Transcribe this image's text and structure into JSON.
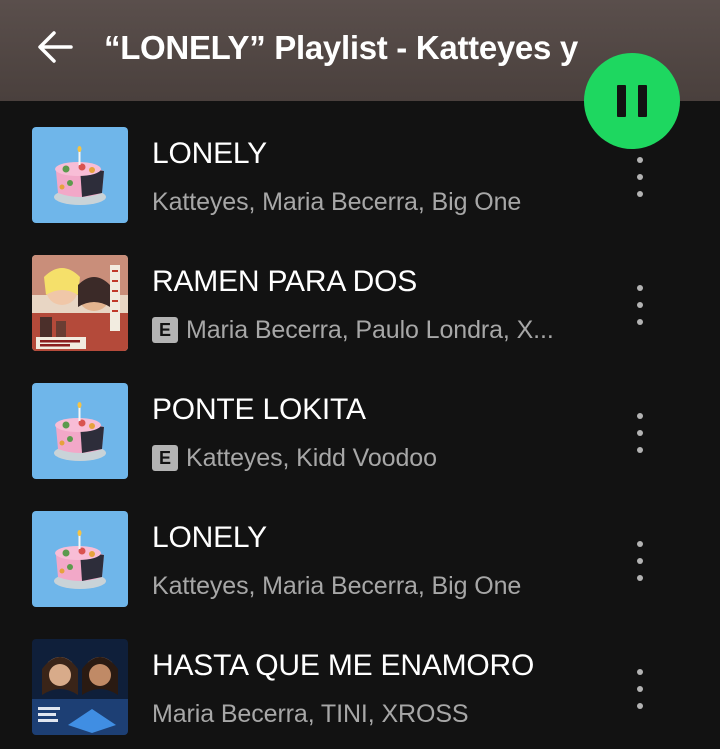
{
  "header": {
    "title": "“LONELY” Playlist - Katteyes y",
    "background": "#4f4542"
  },
  "play_button": {
    "state": "playing",
    "icon": "pause-icon",
    "color": "#1ed760"
  },
  "tracks": [
    {
      "title": "LONELY",
      "artists": "Katteyes, Maria Becerra, Big One",
      "explicit": false,
      "art": "cake-art"
    },
    {
      "title": "RAMEN PARA DOS",
      "artists": "Maria Becerra, Paulo Londra, X...",
      "explicit": true,
      "explicit_label": "E",
      "art": "ramen-art"
    },
    {
      "title": "PONTE LOKITA",
      "artists": "Katteyes, Kidd Voodoo",
      "explicit": true,
      "explicit_label": "E",
      "art": "cake-art"
    },
    {
      "title": "LONELY",
      "artists": "Katteyes, Maria Becerra, Big One",
      "explicit": false,
      "art": "cake-art"
    },
    {
      "title": "HASTA QUE ME ENAMORO",
      "artists": "Maria Becerra, TINI, XROSS",
      "explicit": false,
      "art": "hasta-art"
    }
  ]
}
